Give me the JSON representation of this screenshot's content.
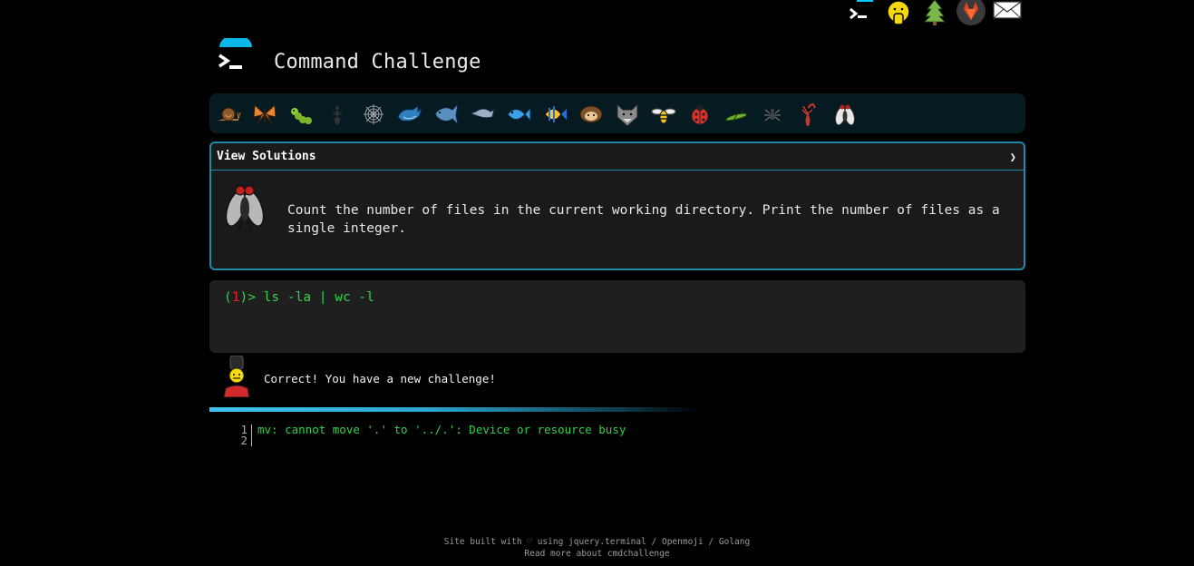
{
  "site": {
    "title": "Command Challenge"
  },
  "top_nav": {
    "icons": [
      "terminal-icon",
      "shushing-face-icon",
      "tree-icon",
      "gitlab-icon",
      "envelope-icon"
    ]
  },
  "challenge_bar": {
    "icons": [
      "snail-icon",
      "butterfly-icon",
      "caterpillar-icon",
      "ant-icon",
      "spider-web-icon",
      "whale-icon",
      "shark-icon",
      "dolphin-icon",
      "fish-icon",
      "tropical-fish-icon",
      "hedgehog-icon",
      "wolf-icon",
      "bee-icon",
      "ladybug-icon",
      "cricket-icon",
      "spider-icon",
      "scorpion-icon",
      "fly-icon"
    ]
  },
  "panel": {
    "header_label": "View Solutions",
    "chevron": "❯",
    "task": "Count the number of files in the current working directory. Print the number of files as a single integer."
  },
  "terminal": {
    "open_paren": "(",
    "prompt_number": "1",
    "prompt_suffix": ")> ",
    "command": "ls -la | wc -l"
  },
  "result": {
    "message": "Correct! You have a new challenge!"
  },
  "output": {
    "lines": [
      {
        "number": "1",
        "text": "mv: cannot move '.' to '../.': Device or resource busy"
      },
      {
        "number": "2",
        "text": ""
      }
    ]
  },
  "footer": {
    "line1": "Site built with ♡ using jquery.terminal / Openmoji / Golang",
    "line2": "Read more about cmdchallenge"
  },
  "colors": {
    "accent": "#1f8aa8",
    "prompt_green": "#2fd24a",
    "prompt_red": "#e22",
    "bar_bg": "#061a22"
  }
}
